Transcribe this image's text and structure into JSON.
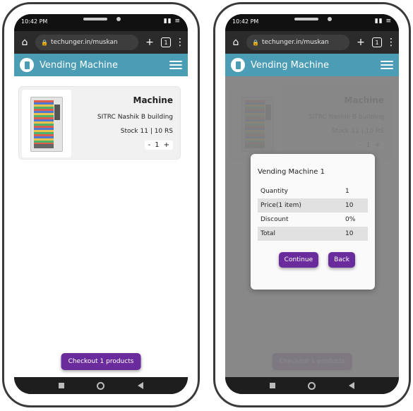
{
  "status": {
    "time": "10:42 PM",
    "icons": "▮▮ ≡"
  },
  "browser": {
    "url": "techunger.in/muskan",
    "tab_count": "1",
    "new_tab_symbol": "+",
    "menu_symbol": "⋮",
    "home_symbol": "⌂"
  },
  "app": {
    "title": "Vending Machine"
  },
  "product": {
    "name": "Machine",
    "location": "SITRC Nashik B building",
    "stock": "Stock 11 | 10 RS",
    "qty_minus": "-",
    "qty_value": "1",
    "qty_plus": "+"
  },
  "checkout_label": "Checkout 1 products",
  "modal": {
    "title": "Vending Machine 1",
    "rows": [
      {
        "label": "Quantity",
        "value": "1"
      },
      {
        "label": "Price(1 item)",
        "value": "10"
      },
      {
        "label": "Discount",
        "value": "0%"
      },
      {
        "label": "Total",
        "value": "10"
      }
    ],
    "continue_label": "Continue",
    "back_label": "Back"
  },
  "colors": {
    "appbar": "#4a9db5",
    "button": "#6a2c9c"
  },
  "icons": {
    "home": "home-icon",
    "lock": "lock-icon",
    "menu": "hamburger-icon",
    "logo": "vending-logo-icon"
  }
}
